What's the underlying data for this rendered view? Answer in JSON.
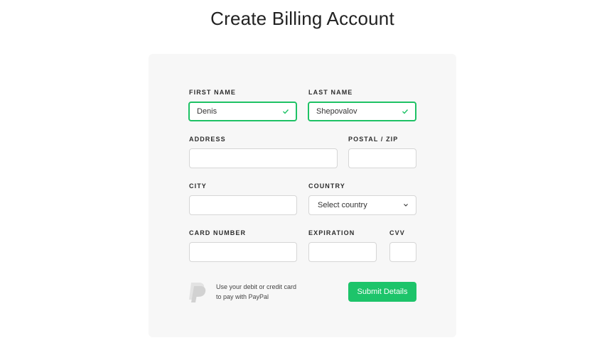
{
  "header": {
    "title": "Create Billing Account"
  },
  "form": {
    "first_name": {
      "label": "FIRST NAME",
      "value": "Denis",
      "status": "valid"
    },
    "last_name": {
      "label": "LAST NAME",
      "value": "Shepovalov",
      "status": "valid"
    },
    "address": {
      "label": "ADDRESS",
      "value": ""
    },
    "postal": {
      "label": "POSTAL / ZIP",
      "value": ""
    },
    "city": {
      "label": "CITY",
      "value": ""
    },
    "country": {
      "label": "COUNTRY",
      "selected": "Select country"
    },
    "card_number": {
      "label": "CARD NUMBER",
      "value": ""
    },
    "expiration": {
      "label": "EXPIRATION",
      "value": ""
    },
    "cvv": {
      "label": "CVV",
      "value": ""
    }
  },
  "paypal": {
    "line1": "Use your debit or credit card",
    "line2": "to pay with PayPal",
    "icon": "paypal-icon"
  },
  "actions": {
    "submit_label": "Submit Details"
  },
  "colors": {
    "accent": "#1dc46a",
    "valid_border": "#1ec265",
    "card_bg": "#f7f7f7"
  }
}
